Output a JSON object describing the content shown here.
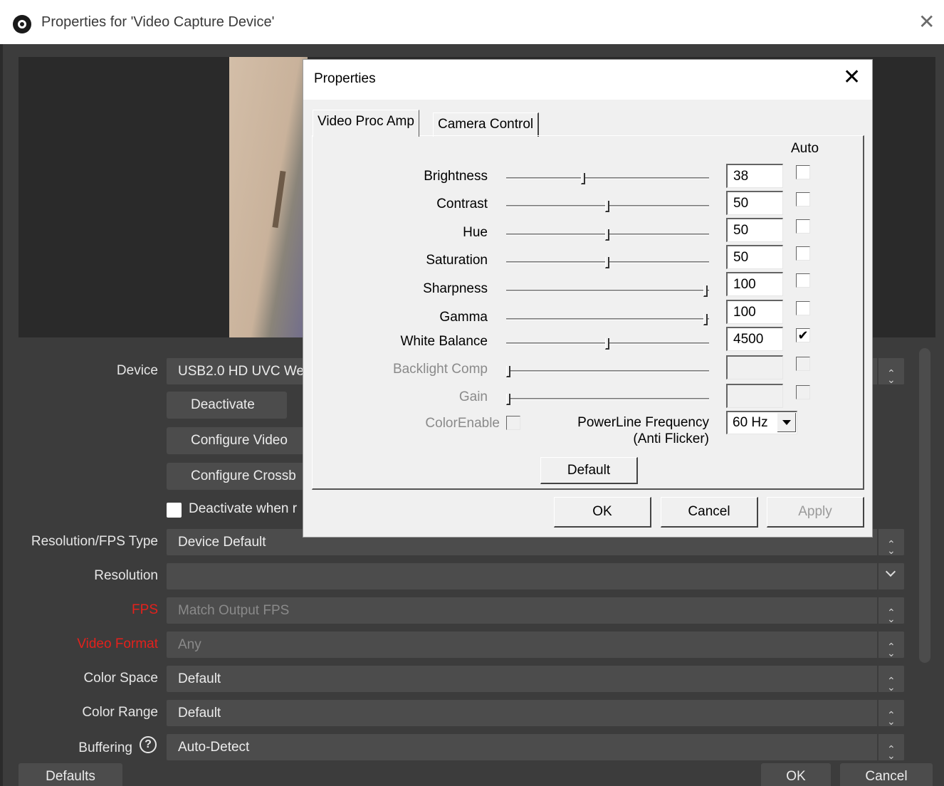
{
  "window": {
    "title": "Properties for 'Video Capture Device'"
  },
  "form": {
    "device": {
      "label": "Device",
      "value": "USB2.0 HD UVC We"
    },
    "deactivate_button": "Deactivate",
    "configure_video_button": "Configure Video",
    "configure_crossbar_button": "Configure Crossb",
    "deactivate_when_label": "Deactivate when r",
    "resolution_fps_type": {
      "label": "Resolution/FPS Type",
      "value": "Device Default"
    },
    "resolution": {
      "label": "Resolution",
      "value": ""
    },
    "fps": {
      "label": "FPS",
      "value": "Match Output FPS"
    },
    "video_format": {
      "label": "Video Format",
      "value": "Any"
    },
    "color_space": {
      "label": "Color Space",
      "value": "Default"
    },
    "color_range": {
      "label": "Color Range",
      "value": "Default"
    },
    "buffering": {
      "label": "Buffering",
      "value": "Auto-Detect",
      "help_icon": "?"
    }
  },
  "bottom": {
    "defaults": "Defaults",
    "ok": "OK",
    "cancel": "Cancel"
  },
  "dialog": {
    "title": "Properties",
    "close_glyph": "✕",
    "tabs": [
      "Video Proc Amp",
      "Camera Control"
    ],
    "auto_header": "Auto",
    "rows": [
      {
        "label": "Brightness",
        "value": "38",
        "level": 0.38,
        "auto": false,
        "enabled": true
      },
      {
        "label": "Contrast",
        "value": "50",
        "level": 0.5,
        "auto": false,
        "enabled": true
      },
      {
        "label": "Hue",
        "value": "50",
        "level": 0.5,
        "auto": false,
        "enabled": true
      },
      {
        "label": "Saturation",
        "value": "50",
        "level": 0.5,
        "auto": false,
        "enabled": true
      },
      {
        "label": "Sharpness",
        "value": "100",
        "level": 1.0,
        "auto": false,
        "enabled": true
      },
      {
        "label": "Gamma",
        "value": "100",
        "level": 1.0,
        "auto": false,
        "enabled": true
      },
      {
        "label": "White Balance",
        "value": "4500",
        "level": 0.5,
        "auto": true,
        "enabled": true
      },
      {
        "label": "Backlight Comp",
        "value": "",
        "level": 0.0,
        "auto": false,
        "enabled": false
      },
      {
        "label": "Gain",
        "value": "",
        "level": 0.0,
        "auto": false,
        "enabled": false
      }
    ],
    "color_enable_label": "ColorEnable",
    "powerline_label_1": "PowerLine Frequency",
    "powerline_label_2": "(Anti Flicker)",
    "powerline_value": "60 Hz",
    "default_button": "Default",
    "ok_button": "OK",
    "cancel_button": "Cancel",
    "apply_button": "Apply"
  }
}
